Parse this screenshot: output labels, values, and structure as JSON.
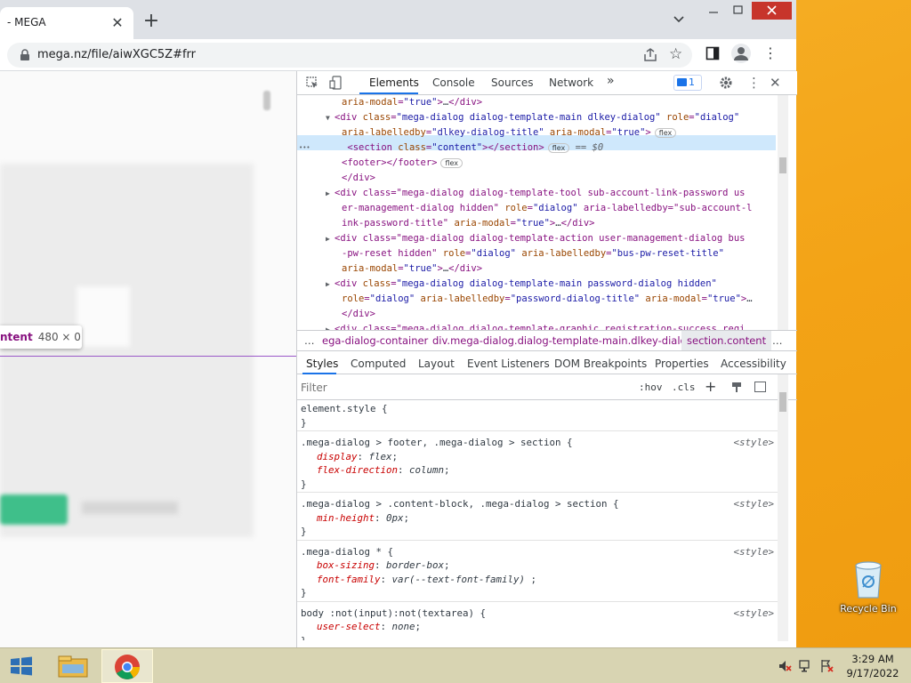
{
  "browser": {
    "tab_title": "- MEGA",
    "url": "mega.nz/file/aiwXGC5Z#frr"
  },
  "page": {
    "inspect_tooltip": {
      "element": "ntent",
      "size": "480 × 0"
    }
  },
  "devtools": {
    "tabs": [
      "Elements",
      "Console",
      "Sources",
      "Network"
    ],
    "issues_count": "1",
    "tree": [
      {
        "indent": 1,
        "html": "aria-modal=\"true\">…</div>"
      },
      {
        "indent": 0,
        "tri": "▼",
        "html": "<div class=\"mega-dialog dialog-template-main dlkey-dialog\" role=\"dialog\""
      },
      {
        "indent": 1,
        "html": "aria-labelledby=\"dlkey-dialog-title\" aria-modal=\"true\">",
        "badge": "flex"
      },
      {
        "indent": 1.8,
        "html": "<section class=\"content\"></section>",
        "badge": "flex",
        "suffix": " == $0"
      },
      {
        "indent": 1,
        "html": "<footer></footer>",
        "badge": "flex"
      },
      {
        "indent": 1,
        "html": "</div>"
      },
      {
        "indent": 0,
        "tri": "▶",
        "html": "<div class=\"mega-dialog dialog-template-tool sub-account-link-password us"
      },
      {
        "indent": 1,
        "html": "er-management-dialog hidden\" role=\"dialog\" aria-labelledby=\"sub-account-l"
      },
      {
        "indent": 1,
        "html": "ink-password-title\" aria-modal=\"true\">…</div>"
      },
      {
        "indent": 0,
        "tri": "▶",
        "html": "<div class=\"mega-dialog dialog-template-action user-management-dialog bus"
      },
      {
        "indent": 1,
        "html": "-pw-reset hidden\" role=\"dialog\" aria-labelledby=\"bus-pw-reset-title\""
      },
      {
        "indent": 1,
        "html": "aria-modal=\"true\">…</div>"
      },
      {
        "indent": 0,
        "tri": "▶",
        "html": "<div class=\"mega-dialog dialog-template-main password-dialog hidden\""
      },
      {
        "indent": 1,
        "html": "role=\"dialog\" aria-labelledby=\"password-dialog-title\" aria-modal=\"true\">…"
      },
      {
        "indent": 1,
        "html": "</div>"
      },
      {
        "indent": 0,
        "tri": "▶",
        "html": "<div class=\"mega-dialog dialog-template-graphic registration-success regi"
      }
    ],
    "breadcrumbs": [
      "…",
      "ega-dialog-container",
      "div.mega-dialog.dialog-template-main.dlkey-dialog",
      "section.content",
      "…"
    ],
    "style_tabs": [
      "Styles",
      "Computed",
      "Layout",
      "Event Listeners",
      "DOM Breakpoints",
      "Properties",
      "Accessibility"
    ],
    "filter_placeholder": "Filter",
    "hov": ":hov",
    "cls": ".cls",
    "rules": [
      {
        "selector": "element.style {",
        "source": "",
        "props": [],
        "close": "}"
      },
      {
        "selector": ".mega-dialog > footer, .mega-dialog > section {",
        "source": "<style>",
        "props": [
          [
            "display",
            "flex"
          ],
          [
            "flex-direction",
            "column"
          ]
        ],
        "close": "}"
      },
      {
        "selector": ".mega-dialog > .content-block, .mega-dialog > section {",
        "source": "<style>",
        "props": [
          [
            "min-height",
            "0px"
          ]
        ],
        "close": "}"
      },
      {
        "selector": ".mega-dialog * {",
        "source": "<style>",
        "props": [
          [
            "box-sizing",
            "border-box"
          ],
          [
            "font-family",
            "var(--text-font-family) "
          ]
        ],
        "close": "}"
      },
      {
        "selector": "body :not(input):not(textarea) {",
        "source": "<style>",
        "props": [
          [
            "user-select",
            "none"
          ]
        ],
        "close": "}"
      }
    ]
  },
  "desktop": {
    "recycle_bin_label": "Recycle Bin"
  },
  "taskbar": {
    "time": "3:29 AM",
    "date": "9/17/2022"
  },
  "colors": {
    "accent": "#1a73e8",
    "wallpaper": "#f3a316",
    "close": "#c7352b"
  }
}
